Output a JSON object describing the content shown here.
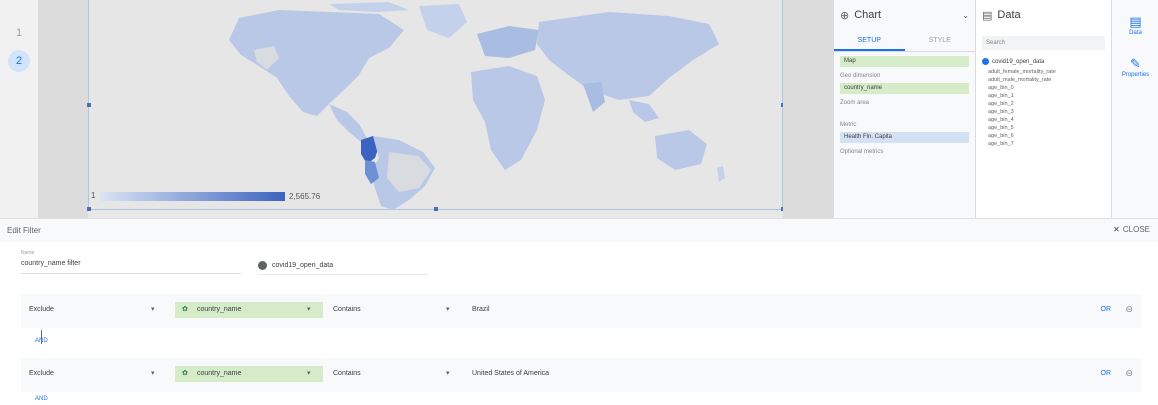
{
  "pages": [
    "1",
    "2"
  ],
  "map": {
    "legend_min": "1",
    "legend_max": "2,565.76",
    "highlighted_countries": [
      "Costa Rica",
      "Colombia",
      "Peru",
      "Ecuador"
    ]
  },
  "chart_panel": {
    "title": "Chart",
    "tabs": [
      "SETUP",
      "STYLE"
    ],
    "chart_type_chip": "Map",
    "geo_dimension_label": "Geo dimension",
    "geo_dimension_chip": "country_name",
    "zoom_area_label": "Zoom area",
    "metric_label": "Metric",
    "metric_chip": "Health Fin. Capita",
    "optional_metrics_label": "Optional metrics"
  },
  "data_panel": {
    "title": "Data",
    "search_placeholder": "Search",
    "source_name": "covid19_open_data",
    "fields": [
      "adult_female_mortality_rate",
      "adult_male_mortality_rate",
      "age_bin_0",
      "age_bin_1",
      "age_bin_2",
      "age_bin_3",
      "age_bin_4",
      "age_bin_5",
      "age_bin_6",
      "age_bin_7"
    ]
  },
  "rail": {
    "data_label": "Data",
    "properties_label": "Properties"
  },
  "edit_filter": {
    "title": "Edit Filter",
    "close_label": "CLOSE",
    "name_label": "Name",
    "name_value": "country_name filter",
    "data_source": "covid19_open_data",
    "clauses": [
      {
        "mode": "Exclude",
        "field": "country_name",
        "operator": "Contains",
        "value": "Brazil",
        "or_label": "OR"
      },
      {
        "mode": "Exclude",
        "field": "country_name",
        "operator": "Contains",
        "value": "United States of America",
        "or_label": "OR"
      }
    ],
    "and_labels": [
      "AND",
      "AND"
    ]
  },
  "colors": {
    "accent": "#1a73e8",
    "map_fill": "#b8c8e6",
    "map_highlight": "#3c63c0",
    "dimension_chip": "#d6ecc8",
    "metric_chip": "#d4e1f5"
  }
}
